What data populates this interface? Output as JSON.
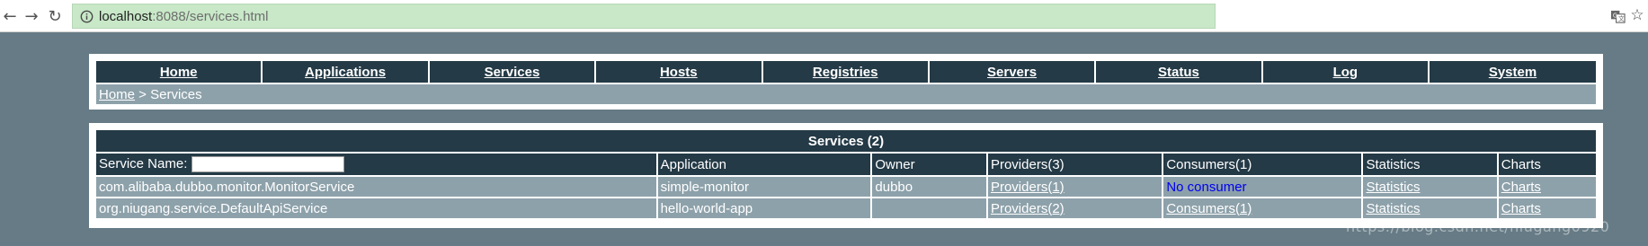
{
  "browser": {
    "url_host": "localhost",
    "url_rest": ":8088/services.html"
  },
  "nav": {
    "items": [
      "Home",
      "Applications",
      "Services",
      "Hosts",
      "Registries",
      "Servers",
      "Status",
      "Log",
      "System"
    ]
  },
  "breadcrumb": {
    "home": "Home",
    "separator": " > ",
    "current": "Services"
  },
  "services": {
    "title": "Services (2)",
    "search_label": "Service Name:",
    "search_value": "",
    "headers": {
      "application": "Application",
      "owner": "Owner",
      "providers": "Providers(3)",
      "consumers": "Consumers(1)",
      "statistics": "Statistics",
      "charts": "Charts"
    },
    "rows": [
      {
        "service": "com.alibaba.dubbo.monitor.MonitorService",
        "application": "simple-monitor",
        "owner": "dubbo",
        "providers": "Providers(1)",
        "consumers": "No consumer",
        "statistics": "Statistics",
        "charts": "Charts"
      },
      {
        "service": "org.niugang.service.DefaultApiService",
        "application": "hello-world-app",
        "owner": "",
        "providers": "Providers(2)",
        "consumers": "Consumers(1)",
        "statistics": "Statistics",
        "charts": "Charts"
      }
    ]
  },
  "watermark": "https://blog.csdn.net/niugang0920",
  "colors": {
    "page_bg": "#667b85",
    "dark_row": "#243a46",
    "grey_row": "#8da1aa",
    "omnibox": "#c8e8c8",
    "no_consumer": "#0000ee"
  }
}
